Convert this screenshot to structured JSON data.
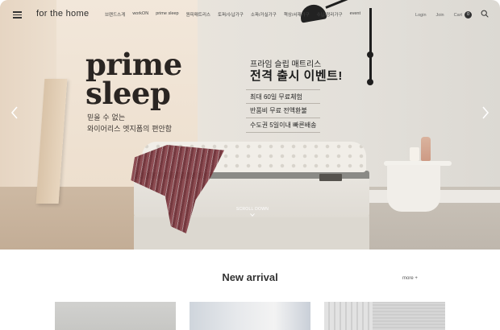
{
  "header": {
    "logo": "for the home",
    "nav": [
      "브랜드스게",
      "workON",
      "prime sleep",
      "원피매트리스",
      "토퍼/수납가구",
      "소파/거실가구",
      "책상/서재가구",
      "수납/정리가구",
      "event"
    ],
    "login": "Login",
    "join": "Join",
    "cart_label": "Cart",
    "cart_count": "0"
  },
  "hero": {
    "title_line1": "prime",
    "title_line2": "sleep",
    "sub_line1": "믿을 수 없는",
    "sub_line2": "와이어리스 엣지폼의 편안함",
    "promo_kicker": "프라임 슬립 매트리스",
    "promo_title": "전격 출시 이벤트!",
    "benefits": [
      "최대 60일 무료체험",
      "반품비 무료 전액환불",
      "수도권 5일이내 빠른배송"
    ],
    "scroll_label": "SCROLL DOWN"
  },
  "new_arrival": {
    "title": "New arrival",
    "more": "more +"
  },
  "icons": {
    "menu": "hamburger-menu-icon",
    "search": "search-icon",
    "prev": "chevron-left-icon",
    "next": "chevron-right-icon",
    "scroll": "chevron-down-icon"
  }
}
